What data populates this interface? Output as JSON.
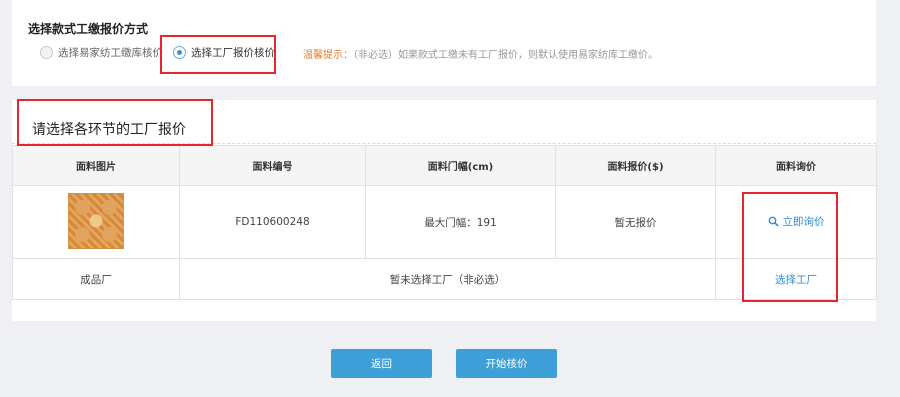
{
  "pricing_method": {
    "title": "选择款式工缴报价方式",
    "options": [
      {
        "label": "选择易家纺工缴库核价",
        "checked": false
      },
      {
        "label": "选择工厂报价核价",
        "checked": true
      }
    ],
    "hint_title": "温馨提示：",
    "hint_body": "（非必选）如果款式工缴未有工厂报价，则默认使用易家纺库工缴价。"
  },
  "factory_section": {
    "title": "请选择各环节的工厂报价",
    "headers": [
      "面料图片",
      "面料编号",
      "面料门幅(cm)",
      "面料报价($)",
      "面料询价"
    ],
    "product_row": {
      "image_icon": "fabric-swatch-image",
      "code": "FD110600248",
      "width": "最大门幅：191",
      "price": "暂无报价",
      "inquiry_label": "立即询价",
      "inquiry_icon": "search-icon"
    },
    "factory_row": {
      "label": "成品厂",
      "status": "暂未选择工厂（非必选）",
      "action_label": "选择工厂"
    }
  },
  "actions": {
    "back_label": "返回",
    "start_label": "开始核价"
  },
  "colors": {
    "accent": "#3e9fd8",
    "link": "#2f8fd0",
    "hint": "#e8792d",
    "annotation_box": "#e8242e"
  }
}
